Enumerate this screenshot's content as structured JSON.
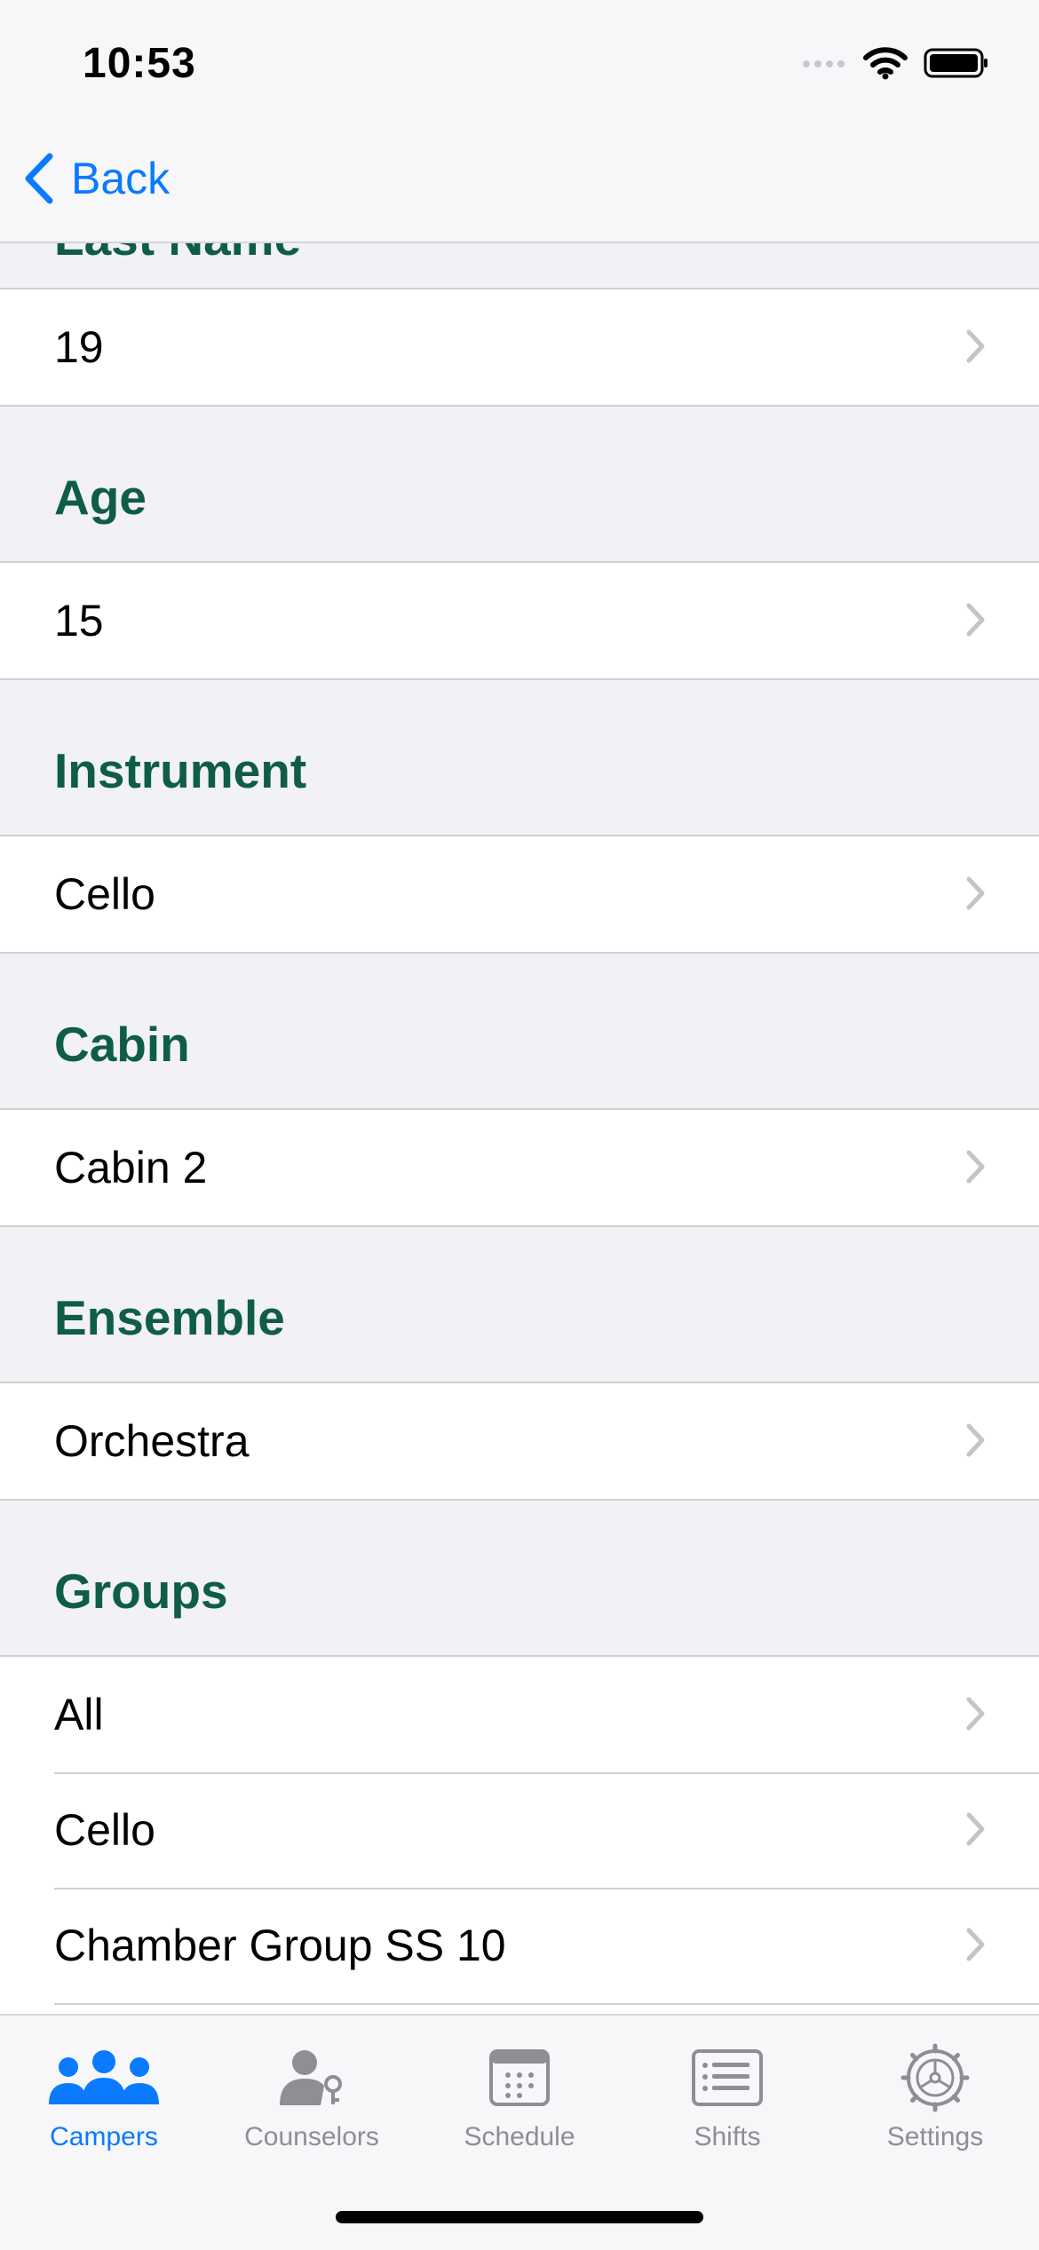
{
  "status": {
    "time": "10:53"
  },
  "nav": {
    "back_label": "Back"
  },
  "clipped_header": "Last Name",
  "first_value": "19",
  "sections": [
    {
      "header": "Age",
      "rows": [
        "15"
      ]
    },
    {
      "header": "Instrument",
      "rows": [
        "Cello"
      ]
    },
    {
      "header": "Cabin",
      "rows": [
        "Cabin 2"
      ]
    },
    {
      "header": "Ensemble",
      "rows": [
        "Orchestra"
      ]
    },
    {
      "header": "Groups",
      "rows": [
        "All",
        "Cello",
        "Chamber Group SS 10"
      ]
    }
  ],
  "tabs": [
    {
      "label": "Campers",
      "icon": "campers-icon",
      "active": true
    },
    {
      "label": "Counselors",
      "icon": "counselors-icon",
      "active": false
    },
    {
      "label": "Schedule",
      "icon": "schedule-icon",
      "active": false
    },
    {
      "label": "Shifts",
      "icon": "shifts-icon",
      "active": false
    },
    {
      "label": "Settings",
      "icon": "settings-icon",
      "active": false
    }
  ],
  "colors": {
    "accent": "#0a7aff",
    "header_text": "#0e5d44",
    "inactive": "#8e8e93"
  }
}
